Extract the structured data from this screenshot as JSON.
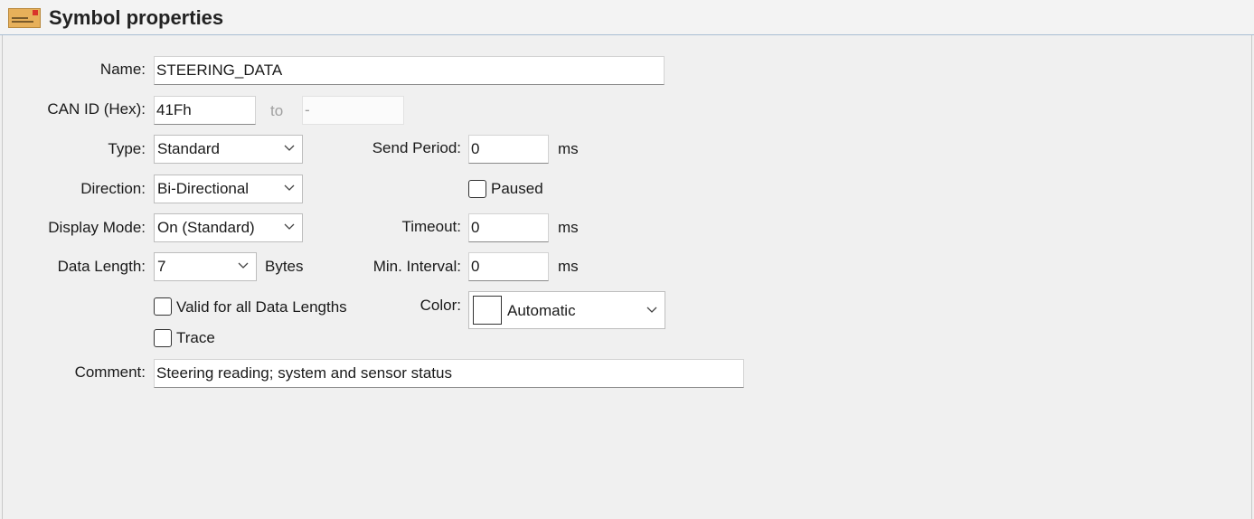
{
  "header": {
    "title": "Symbol properties",
    "icon": "message-envelope-icon",
    "icon_color": "#e7b05a",
    "accent_color": "#d9332a"
  },
  "form": {
    "name": {
      "label": "Name:",
      "value": "STEERING_DATA"
    },
    "can_id": {
      "label": "CAN ID (Hex):",
      "value": "41Fh",
      "to_label": "to",
      "to_value": "-"
    },
    "type": {
      "label": "Type:",
      "value": "Standard"
    },
    "direction": {
      "label": "Direction:",
      "value": "Bi-Directional"
    },
    "display_mode": {
      "label": "Display Mode:",
      "value": "On (Standard)"
    },
    "data_length": {
      "label": "Data Length:",
      "value": "7",
      "unit": "Bytes"
    },
    "valid_all_lengths": {
      "label": "Valid for all Data Lengths",
      "checked": false
    },
    "trace": {
      "label": "Trace",
      "checked": false
    },
    "comment": {
      "label": "Comment:",
      "value": "Steering reading; system and sensor status"
    },
    "send_period": {
      "label": "Send Period:",
      "value": "0",
      "unit": "ms"
    },
    "paused": {
      "label": "Paused",
      "checked": false
    },
    "timeout": {
      "label": "Timeout:",
      "value": "0",
      "unit": "ms"
    },
    "min_interval": {
      "label": "Min. Interval:",
      "value": "0",
      "unit": "ms"
    },
    "color": {
      "label": "Color:",
      "value": "Automatic",
      "swatch": "#ffffff"
    }
  }
}
